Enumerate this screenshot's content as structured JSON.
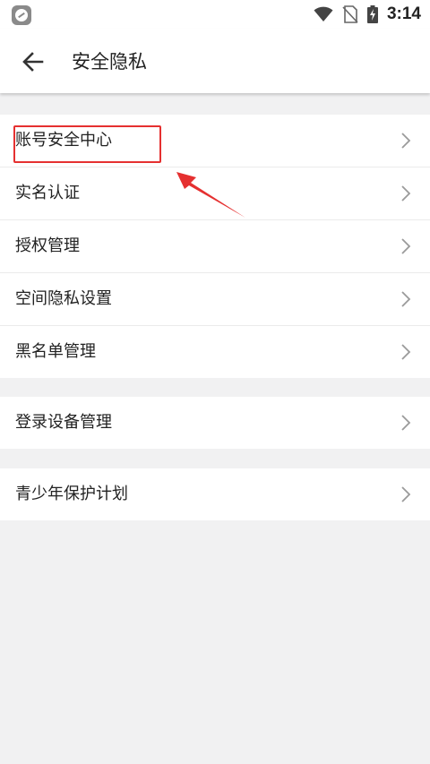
{
  "status_bar": {
    "time": "3:14",
    "icons": [
      "app-notification-icon",
      "wifi-icon",
      "no-sim-icon",
      "battery-charging-icon"
    ]
  },
  "app_bar": {
    "back_icon": "arrow-left-icon",
    "title": "安全隐私"
  },
  "groups": [
    {
      "items": [
        {
          "label": "账号安全中心",
          "highlighted": true
        },
        {
          "label": "实名认证"
        },
        {
          "label": "授权管理"
        },
        {
          "label": "空间隐私设置"
        },
        {
          "label": "黑名单管理"
        }
      ]
    },
    {
      "items": [
        {
          "label": "登录设备管理"
        }
      ]
    },
    {
      "items": [
        {
          "label": "青少年保护计划"
        }
      ]
    }
  ],
  "annotation": {
    "box_color": "#e53030",
    "arrow_color": "#e53030"
  },
  "colors": {
    "background": "#f1f1f2",
    "surface": "#ffffff",
    "text": "#222222",
    "chevron": "#9a9a9a"
  }
}
